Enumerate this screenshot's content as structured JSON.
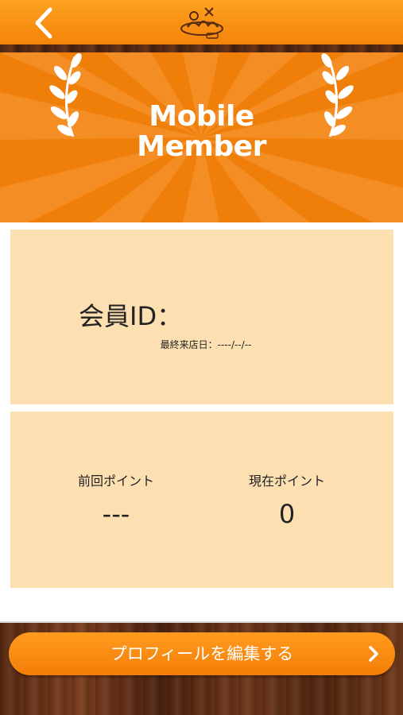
{
  "header": {
    "back_icon": "chevron-left-icon",
    "logo_icon": "brand-logo-icon",
    "colors": {
      "top": "#fda21f",
      "bottom": "#f5830b"
    }
  },
  "banner": {
    "title_line1": "Mobile",
    "title_line2": "Member",
    "left_icon": "laurel-branch-icon",
    "right_icon": "laurel-branch-icon",
    "color": "#f07f0a"
  },
  "member_card": {
    "id_label": "会員ID：",
    "id_value": "",
    "last_visit_label": "最終来店日：",
    "last_visit_value": "----/--/--",
    "color": "#fde0b2"
  },
  "points_card": {
    "previous_label": "前回ポイント",
    "previous_value": "---",
    "current_label": "現在ポイント",
    "current_value": "0"
  },
  "footer": {
    "edit_profile_label": "プロフィールを編集する",
    "edit_profile_icon": "chevron-right-icon",
    "button_color": "#f47e08"
  }
}
